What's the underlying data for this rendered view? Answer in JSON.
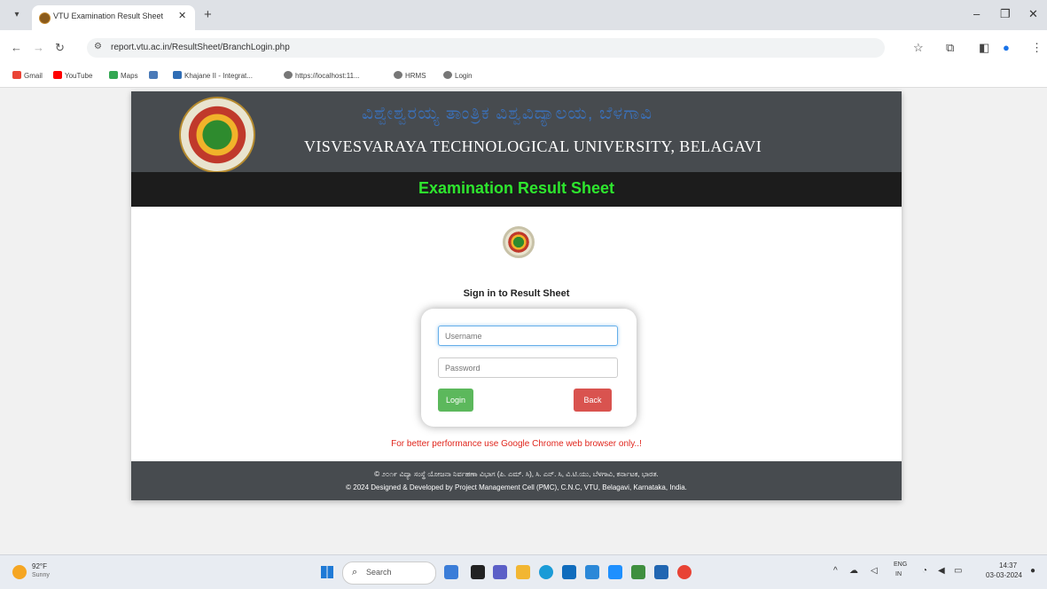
{
  "browser": {
    "tab_title": "VTU Examination Result Sheet",
    "new_tab": "+",
    "url": "report.vtu.ac.in/ResultSheet/BranchLogin.php",
    "bookmarks": [
      "Gmail",
      "YouTube",
      "Maps",
      "Khajane II - Integrat...",
      "https://localhost:11...",
      "HRMS",
      "Login"
    ]
  },
  "header": {
    "kannada_title": "ವಿಶ್ವೇಶ್ವರಯ್ಯ ತಾಂತ್ರಿಕ ವಿಶ್ವವಿದ್ಯಾಲಯ, ಬೆಳಗಾವಿ",
    "university_name": "VISVESVARAYA TECHNOLOGICAL UNIVERSITY, BELAGAVI",
    "result_title": "Examination Result Sheet"
  },
  "login": {
    "heading": "Sign in to Result Sheet",
    "username_placeholder": "Username",
    "password_placeholder": "Password",
    "login_label": "Login",
    "back_label": "Back",
    "notice": "For better performance use Google Chrome web browser only..!"
  },
  "footer": {
    "line1": "© ೨೦೧೯ ವಿದ್ಯಾ ಸಂಸ್ಥೆ ಯೋಜನಾ ನಿರ್ವಹಣಾ ವಿಭಾಗ (ಪಿ. ಎಮ್. ಸಿ), ಸಿ. ಎನ್. ಸಿ, ವಿ.ಟಿ.ಯು, ಬೆಳಗಾವಿ, ಕರ್ನಾಟಕ, ಭಾರತ.",
    "line2": "© 2024 Designed & Developed by Project Management Cell (PMC), C.N.C, VTU, Belagavi, Karnataka, India."
  },
  "taskbar": {
    "temperature": "92°F",
    "condition": "Sunny",
    "search_label": "Search",
    "lang_line1": "ENG",
    "lang_line2": "IN",
    "time": "14:37",
    "date": "03-03-2024"
  }
}
